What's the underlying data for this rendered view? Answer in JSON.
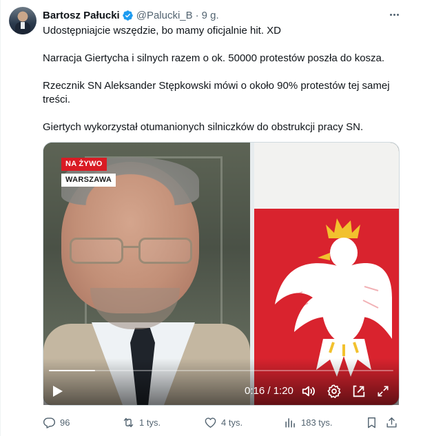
{
  "author": {
    "name": "Bartosz Pałucki",
    "handle": "@Palucki_B",
    "separator": "·",
    "time": "9 g."
  },
  "tweet": {
    "paragraphs": [
      "Udostępniajcie wszędzie, bo mamy oficjalnie hit. XD",
      "Narracja Giertycha i silnych razem o ok. 50000 protestów poszła do kosza.",
      "Rzecznik SN Aleksander Stępkowski mówi o około 90% protestów tej samej treści.",
      "Giertych wykorzystał otumanionych silniczków do obstrukcji pracy SN."
    ]
  },
  "video": {
    "live_label": "NA ŻYWO",
    "location_label": "WARSZAWA",
    "timer": "0:16 / 1:20",
    "progress": 0.133
  },
  "actions": {
    "replies": "96",
    "retweets": "1 tys.",
    "likes": "4 tys.",
    "views": "183 tys."
  },
  "colors": {
    "verified": "#1d9bf0",
    "text_secondary": "#536471",
    "live_red": "#d91b24",
    "flag_red": "#d9232e"
  },
  "icons": [
    "verified-badge-icon",
    "more-icon",
    "play-icon",
    "volume-icon",
    "settings-icon",
    "pip-icon",
    "fullscreen-icon",
    "reply-icon",
    "retweet-icon",
    "like-icon",
    "views-icon",
    "bookmark-icon",
    "share-icon"
  ]
}
